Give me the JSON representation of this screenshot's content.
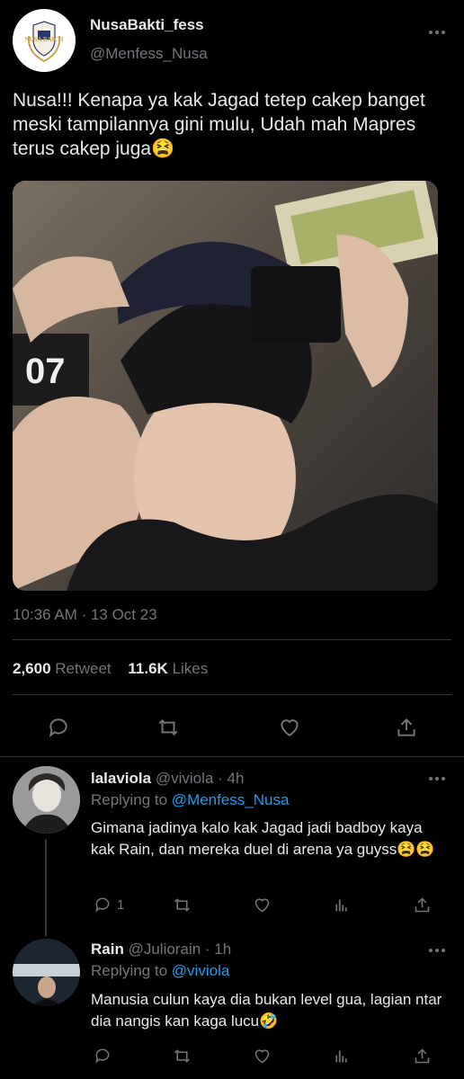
{
  "main_tweet": {
    "display_name": "NusaBakti_fess",
    "handle": "@Menfess_Nusa",
    "avatar_text_top": "NUSA BAKTI",
    "text": "Nusa!!! Kenapa ya kak Jagad tetep cakep banget meski tampilannya gini mulu, Udah mah Mapres terus cakep juga😫",
    "photo_text": "07",
    "time": "10:36 AM",
    "date": "13 Oct 23",
    "retweet_count": "2,600",
    "retweet_label": "Retweet",
    "like_count": "11.6K",
    "like_label": "Likes"
  },
  "replies": [
    {
      "display_name": "lalaviola",
      "handle": "@viviola",
      "time": "4h",
      "replying_label": "Replying to",
      "replying_to": "@Menfess_Nusa",
      "text": "Gimana jadinya kalo kak Jagad jadi badboy kaya kak Rain, dan mereka duel di arena ya guyss😫😫",
      "reply_count": "1"
    },
    {
      "display_name": "Rain",
      "handle": "@Juliorain",
      "time": "1h",
      "replying_label": "Replying to",
      "replying_to": "@viviola",
      "text": "Manusia culun kaya dia bukan level gua, lagian ntar dia nangis kan kaga lucu🤣",
      "reply_count": ""
    }
  ],
  "colors": {
    "background": "#000000",
    "text": "#e7e9ea",
    "muted": "#71767b",
    "link": "#1d9bf0",
    "divider": "#2f3336"
  },
  "icons": [
    "more-icon",
    "reply-icon",
    "retweet-icon",
    "like-icon",
    "share-icon",
    "analytics-icon"
  ]
}
